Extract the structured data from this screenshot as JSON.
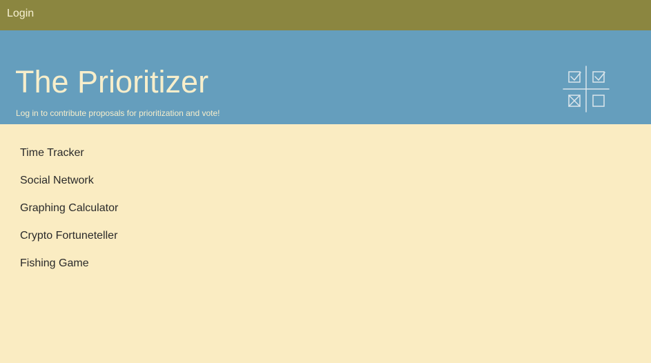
{
  "topbar": {
    "login_label": "Login",
    "background": "#8b8640"
  },
  "hero": {
    "title": "The Prioritizer",
    "subtitle": "Log in to contribute proposals for prioritization and vote!",
    "background": "#659ebd",
    "text_color": "#f7eecb",
    "logo_icon": "checkbox-grid-icon"
  },
  "proposals": {
    "items": [
      {
        "label": "Time Tracker"
      },
      {
        "label": "Social Network"
      },
      {
        "label": "Graphing Calculator"
      },
      {
        "label": "Crypto Fortuneteller"
      },
      {
        "label": "Fishing Game"
      }
    ]
  },
  "page": {
    "background": "#faecc2"
  }
}
